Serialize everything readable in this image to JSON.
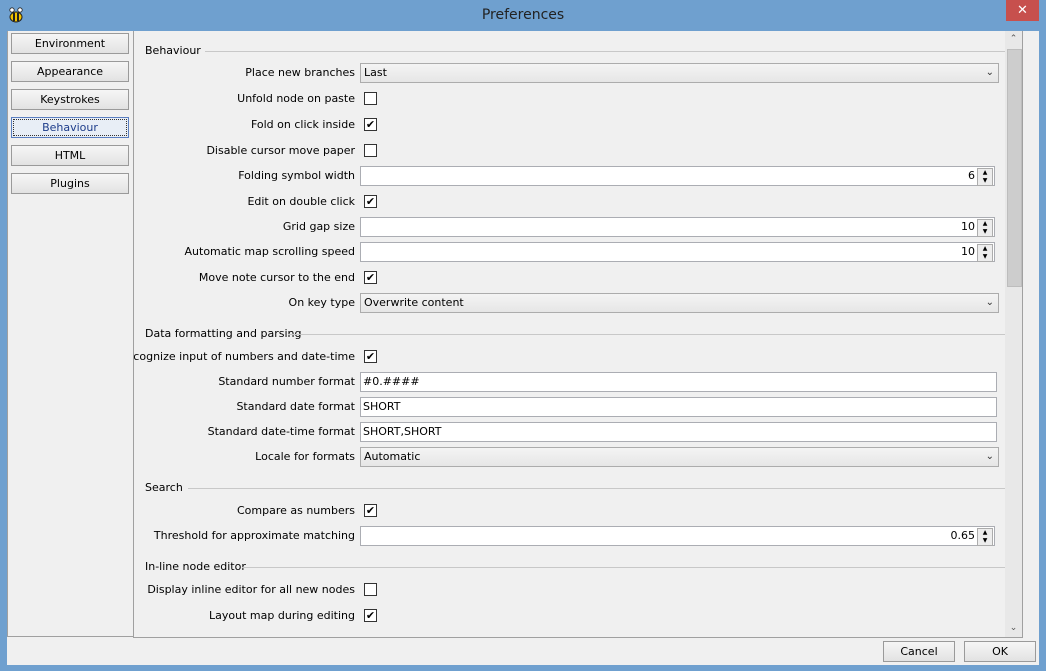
{
  "window": {
    "title": "Preferences",
    "close_label": "✕"
  },
  "sidebar": {
    "items": [
      {
        "label": "Environment"
      },
      {
        "label": "Appearance"
      },
      {
        "label": "Keystrokes"
      },
      {
        "label": "Behaviour",
        "active": true
      },
      {
        "label": "HTML"
      },
      {
        "label": "Plugins"
      }
    ]
  },
  "behaviour": {
    "header": "Behaviour",
    "place_new_branches": {
      "label": "Place new branches",
      "value": "Last"
    },
    "unfold_node_on_paste": {
      "label": "Unfold node on paste",
      "checked": false
    },
    "fold_on_click_inside": {
      "label": "Fold on click inside",
      "checked": true
    },
    "disable_cursor_move_paper": {
      "label": "Disable cursor move paper",
      "checked": false
    },
    "folding_symbol_width": {
      "label": "Folding symbol width",
      "value": "6"
    },
    "edit_on_double_click": {
      "label": "Edit on double click",
      "checked": true
    },
    "grid_gap_size": {
      "label": "Grid gap size",
      "value": "10"
    },
    "automatic_map_scrolling_speed": {
      "label": "Automatic map scrolling speed",
      "value": "10"
    },
    "move_note_cursor_to_end": {
      "label": "Move note cursor to the end",
      "checked": true
    },
    "on_key_type": {
      "label": "On key type",
      "value": "Overwrite content"
    }
  },
  "data_formatting": {
    "header": "Data formatting and parsing",
    "recognize_input": {
      "label": "Recognize input of numbers and date-time",
      "checked": true
    },
    "standard_number_format": {
      "label": "Standard number format",
      "value": "#0.####"
    },
    "standard_date_format": {
      "label": "Standard date format",
      "value": "SHORT"
    },
    "standard_datetime_format": {
      "label": "Standard date-time format",
      "value": "SHORT,SHORT"
    },
    "locale_for_formats": {
      "label": "Locale for formats",
      "value": "Automatic"
    }
  },
  "search": {
    "header": "Search",
    "compare_as_numbers": {
      "label": "Compare as numbers",
      "checked": true
    },
    "threshold": {
      "label": "Threshold for approximate matching",
      "value": "0.65"
    }
  },
  "inline_editor": {
    "header": "In-line node editor",
    "display_inline_editor": {
      "label": "Display inline editor for all new nodes",
      "checked": false
    },
    "layout_map_during_editing": {
      "label": "Layout map during editing",
      "checked": true
    }
  },
  "footer": {
    "cancel_label": "Cancel",
    "ok_label": "OK"
  },
  "icons": {
    "check": "✔",
    "chevron_down": "⌄",
    "spin_up": "▲",
    "spin_down": "▼",
    "scroll_up": "⌃",
    "scroll_down": "⌄"
  }
}
